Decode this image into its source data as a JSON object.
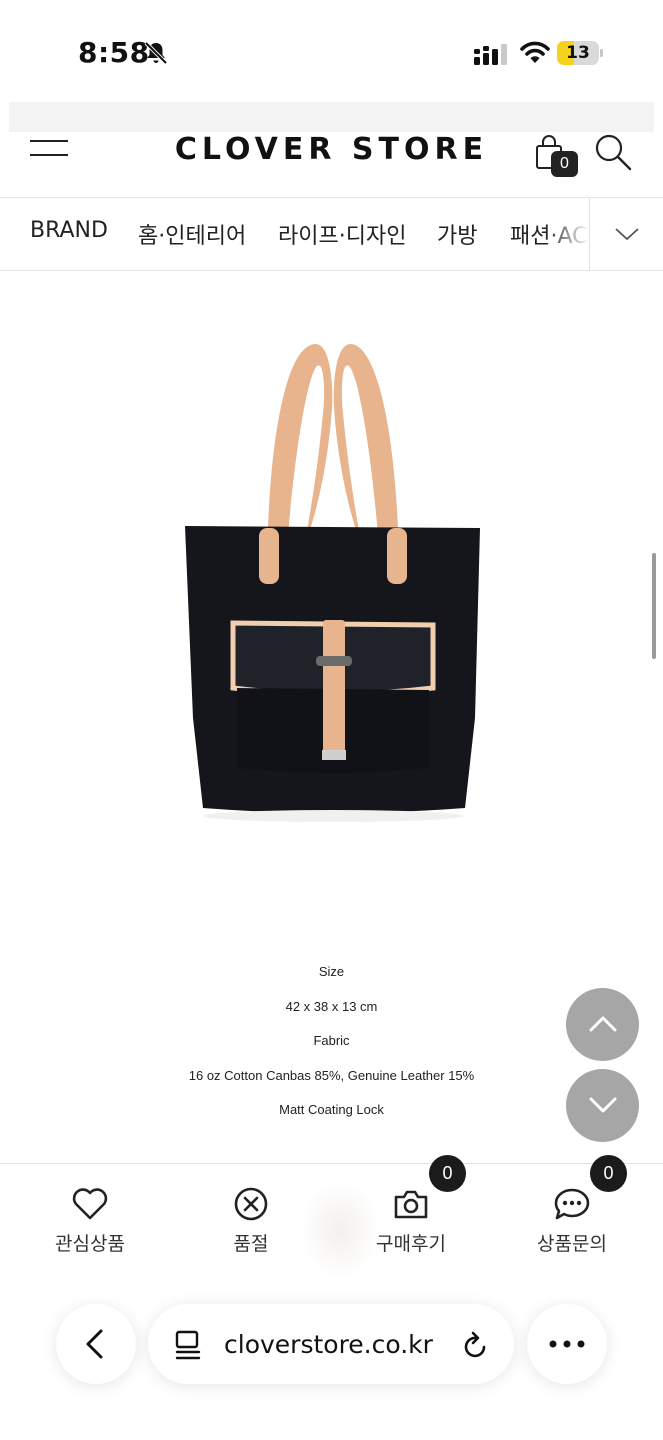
{
  "status_bar": {
    "time": "8:58",
    "battery_level": "13",
    "battery_fraction": 0.13,
    "icons": [
      "bell-slash-icon",
      "cellular-signal-icon",
      "wifi-icon",
      "battery-icon"
    ]
  },
  "header": {
    "logo": "CLOVER STORE",
    "cart_count": "0",
    "icons": [
      "hamburger-menu-icon",
      "shopping-bag-icon",
      "search-icon"
    ]
  },
  "category_nav": {
    "items": [
      {
        "label": "BRAND"
      },
      {
        "label": "홈·인테리어"
      },
      {
        "label": "라이프·디자인"
      },
      {
        "label": "가방"
      },
      {
        "label": "패션·AC"
      }
    ],
    "expand_icon": "chevron-down-icon"
  },
  "product": {
    "image_description_icon": "tote-bag-image",
    "colors": {
      "bag": "#15161c",
      "leather": "#e7b48d"
    }
  },
  "specs": {
    "lines": [
      "Size",
      "42 x 38 x 13 cm",
      "Fabric",
      "16 oz Cotton Canbas 85%, Genuine Leather 15%",
      "Matt Coating Lock"
    ]
  },
  "floating_buttons": {
    "up_icon": "chevron-up-icon",
    "down_icon": "chevron-down-icon"
  },
  "action_bar": {
    "items": [
      {
        "label": "관심상품",
        "icon": "heart-icon"
      },
      {
        "label": "품절",
        "icon": "circle-x-icon"
      },
      {
        "label": "구매후기",
        "icon": "camera-icon",
        "badge": "0"
      },
      {
        "label": "상품문의",
        "icon": "chat-bubble-icon",
        "badge": "0"
      }
    ]
  },
  "browser_bar": {
    "url": "cloverstore.co.kr",
    "icons": [
      "back-icon",
      "tab-overview-icon",
      "reload-icon",
      "more-icon"
    ]
  }
}
